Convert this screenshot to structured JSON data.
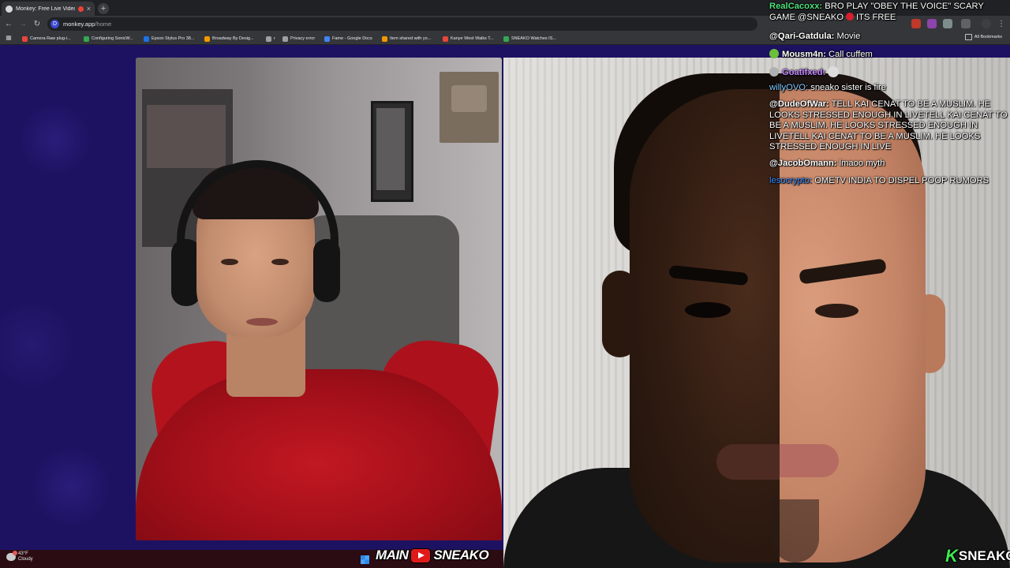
{
  "browser": {
    "tab_title": "Monkey: Free Live Video Ch",
    "new_tab": "+",
    "url_host": "monkey.app",
    "url_path": "/home",
    "bookmarks": [
      {
        "label": "Camera Raw plug-i...",
        "color": "#e8453c"
      },
      {
        "label": "Configuring SonicW...",
        "color": "#34a853"
      },
      {
        "label": "Epson Stylus Pro 38...",
        "color": "#1a73e8"
      },
      {
        "label": "Broadway By Desig...",
        "color": "#f29900"
      },
      {
        "label": "r",
        "color": "#9aa0a6"
      },
      {
        "label": "Privacy error",
        "color": "#9aa0a6"
      },
      {
        "label": "Fame - Google Docs",
        "color": "#4285f4"
      },
      {
        "label": "Item shared with yo...",
        "color": "#f29900"
      },
      {
        "label": "Kanye West Walks T...",
        "color": "#e8453c"
      },
      {
        "label": "SNEAKO Watches IS...",
        "color": "#34a853"
      }
    ],
    "all_bookmarks": "All Bookmarks"
  },
  "chat": [
    {
      "user": "RealCacoxx:",
      "user_color": "#4fe07a",
      "text": "BRO PLAY \"OBEY THE VOICE\" SCARY GAME @SNEAKO",
      "suffix": "ITS FREE"
    },
    {
      "user": "@Qari-Gatdula:",
      "user_color": "#ffffff",
      "text": "Movie"
    },
    {
      "user": "Mousm4n:",
      "user_color": "#ffffff",
      "text": "Call cuffem",
      "badge": "#6bbf3a"
    },
    {
      "user": "Goatifxed:",
      "user_color": "#c283ff",
      "text": "",
      "badge": "#b0b0b0"
    },
    {
      "user": "willyOVO:",
      "user_color": "#7ec8ff",
      "text": "sneako sister is fire"
    },
    {
      "user": "@DudeOfWar:",
      "user_color": "#ffffff",
      "text": "TELL KAI CENAT TO BE A MUSLIM. HE LOOKS STRESSED ENOUGH IN LIVETELL KAI CENAT TO BE A MUSLIM. HE LOOKS STRESSED ENOUGH IN LIVETELL KAI CENAT TO BE A MUSLIM. HE LOOKS STRESSED ENOUGH IN LIVE"
    },
    {
      "user": "@JacobOmann:",
      "user_color": "#ffffff",
      "text": "lmaoo myth"
    },
    {
      "user": "lesocrypto:",
      "user_color": "#3b8cff",
      "text": "OMETV INDIA TO DISPEL POOP RUMORS"
    }
  ],
  "taskbar": {
    "temperature": "43°F",
    "condition": "Cloudy"
  },
  "overlays": {
    "main_word": "MAIN",
    "sneako_word": "SNEAKO",
    "k_letter": "K",
    "brand_word": "SNEAKO"
  },
  "colors": {
    "page_bg": "#1d1262",
    "hoodie": "#b3131d",
    "k_green": "#3ee84f",
    "youtube_red": "#e01a1a"
  }
}
